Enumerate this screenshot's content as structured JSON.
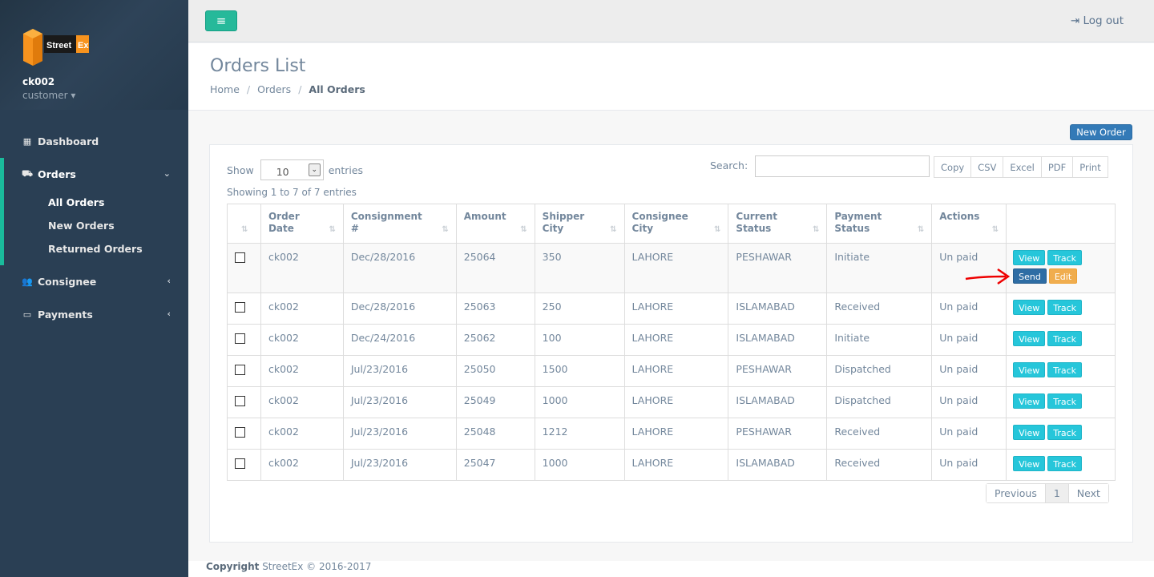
{
  "brand": {
    "logo_text": "Street Ex",
    "colors": {
      "logo_orange": "#f7931e",
      "accent": "#1abb9c"
    }
  },
  "profile": {
    "username": "ck002",
    "role": "customer"
  },
  "sidebar": {
    "items": [
      {
        "label": "Dashboard",
        "icon": "dashboard-icon"
      },
      {
        "label": "Orders",
        "icon": "truck-icon"
      },
      {
        "label": "Consignee",
        "icon": "users-icon"
      },
      {
        "label": "Payments",
        "icon": "credit-card-icon"
      }
    ],
    "orders_submenu": [
      "All Orders",
      "New Orders",
      "Returned Orders"
    ]
  },
  "topnav": {
    "logout_label": "Log out"
  },
  "page": {
    "title": "Orders List",
    "breadcrumb": [
      "Home",
      "Orders",
      "All Orders"
    ]
  },
  "toolbar": {
    "new_order_label": "New Order",
    "show_label": "Show",
    "entries_label": "entries",
    "page_size": "10",
    "search_label": "Search:",
    "search_value": "",
    "export_buttons": [
      "Copy",
      "CSV",
      "Excel",
      "PDF",
      "Print"
    ],
    "info": "Showing 1 to 7 of 7 entries"
  },
  "table": {
    "headers": [
      [
        "Order",
        "Date"
      ],
      [
        "Consignment",
        "#"
      ],
      [
        "Amount",
        ""
      ],
      [
        "Shipper",
        "City"
      ],
      [
        "Consignee",
        "City"
      ],
      [
        "Current",
        "Status"
      ],
      [
        "Payment",
        "Status"
      ],
      [
        "Actions",
        ""
      ]
    ],
    "buttons": {
      "view": "View",
      "track": "Track",
      "send": "Send",
      "edit": "Edit"
    },
    "rows": [
      [
        "ck002",
        "Dec/28/2016",
        "25064",
        "350",
        "LAHORE",
        "PESHAWAR",
        "Initiate",
        "Un paid"
      ],
      [
        "ck002",
        "Dec/28/2016",
        "25063",
        "250",
        "LAHORE",
        "ISLAMABAD",
        "Received",
        "Un paid"
      ],
      [
        "ck002",
        "Dec/24/2016",
        "25062",
        "100",
        "LAHORE",
        "ISLAMABAD",
        "Initiate",
        "Un paid"
      ],
      [
        "ck002",
        "Jul/23/2016",
        "25050",
        "1500",
        "LAHORE",
        "PESHAWAR",
        "Dispatched",
        "Un paid"
      ],
      [
        "ck002",
        "Jul/23/2016",
        "25049",
        "1000",
        "LAHORE",
        "ISLAMABAD",
        "Dispatched",
        "Un paid"
      ],
      [
        "ck002",
        "Jul/23/2016",
        "25048",
        "1212",
        "LAHORE",
        "PESHAWAR",
        "Received",
        "Un paid"
      ],
      [
        "ck002",
        "Jul/23/2016",
        "25047",
        "1000",
        "LAHORE",
        "ISLAMABAD",
        "Received",
        "Un paid"
      ]
    ]
  },
  "pagination": {
    "previous": "Previous",
    "current": "1",
    "next": "Next"
  },
  "footer": {
    "bold": "Copyright",
    "text": " StreetEx © 2016-2017"
  }
}
